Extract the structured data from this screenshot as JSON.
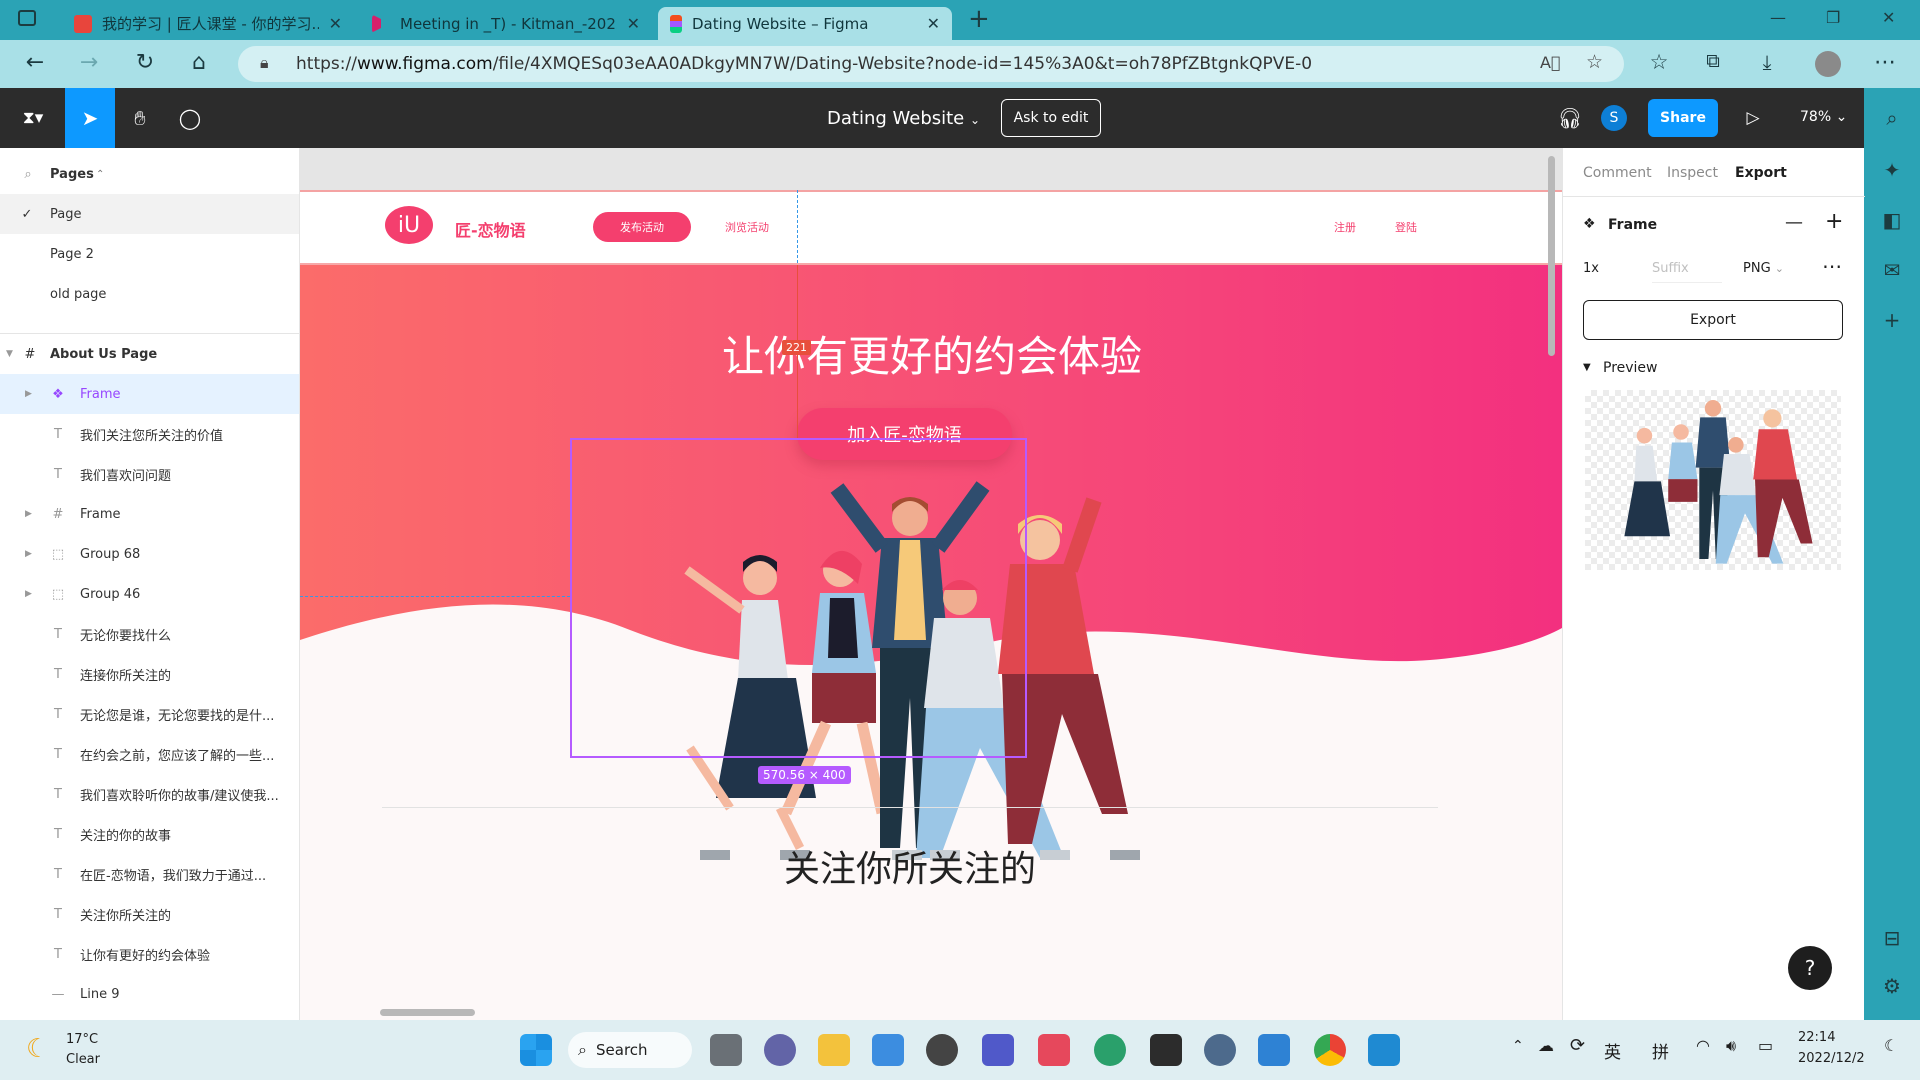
{
  "browser": {
    "tabs": [
      {
        "label": "我的学习 | 匠人课堂 - 你的学习..."
      },
      {
        "label": "Meeting in _T) - Kitman_-2022..."
      },
      {
        "label": "Dating Website – Figma"
      }
    ],
    "url_prefix": "https://",
    "url_main": "www.figma.com",
    "url_rest": "/file/4XMQESq03eAA0ADkgyMN7W/Dating-Website?node-id=145%3A0&t=oh78PfZBtgnkQPVE-0"
  },
  "figma": {
    "doc_title": "Dating Website",
    "ask_to_edit": "Ask to edit",
    "share": "Share",
    "avatar": "S",
    "zoom": "78%"
  },
  "layers": {
    "pages_header": "Pages",
    "pages": [
      "Page",
      "Page 2",
      "old page"
    ],
    "section": "About Us Page",
    "items": [
      {
        "icon": "component-icon",
        "label": "Frame",
        "expand": true,
        "selected": true
      },
      {
        "icon": "text-icon",
        "label": "我们关注您所关注的价值"
      },
      {
        "icon": "text-icon",
        "label": "我们喜欢问问题"
      },
      {
        "icon": "frame-icon",
        "label": "Frame",
        "expand": true
      },
      {
        "icon": "group-icon",
        "label": "Group 68",
        "expand": true
      },
      {
        "icon": "group-icon",
        "label": "Group 46",
        "expand": true
      },
      {
        "icon": "text-icon",
        "label": "无论你要找什么"
      },
      {
        "icon": "text-icon",
        "label": "连接你所关注的"
      },
      {
        "icon": "text-icon",
        "label": "无论您是谁，无论您要找的是什..."
      },
      {
        "icon": "text-icon",
        "label": "在约会之前，您应该了解的一些..."
      },
      {
        "icon": "text-icon",
        "label": "我们喜欢聆听你的故事/建议使我..."
      },
      {
        "icon": "text-icon",
        "label": "关注的你的故事"
      },
      {
        "icon": "text-icon",
        "label": "在匠-恋物语，我们致力于通过..."
      },
      {
        "icon": "text-icon",
        "label": "关注你所关注的"
      },
      {
        "icon": "text-icon",
        "label": "让你有更好的约会体验"
      },
      {
        "icon": "line-icon",
        "label": "Line 9"
      }
    ]
  },
  "design": {
    "logo": "iU",
    "brand": "匠-恋物语",
    "nav_publish": "发布活动",
    "nav_browse": "浏览活动",
    "nav_register": "注册",
    "nav_login": "登陆",
    "hero_title": "让你有更好的约会体验",
    "hero_cta": "加入匠-恋物语",
    "measure": "221",
    "frame_size": "570.56 × 400",
    "section_title": "关注你所关注的",
    "accent": "#f43f6e"
  },
  "inspector": {
    "tabs": [
      "Comment",
      "Inspect",
      "Export"
    ],
    "active_tab": "Export",
    "frame_label": "Frame",
    "scale": "1x",
    "suffix_placeholder": "Suffix",
    "format": "PNG",
    "export_button": "Export",
    "preview_label": "Preview"
  },
  "taskbar": {
    "weather_temp": "17°C",
    "weather_desc": "Clear",
    "search": "Search",
    "ime1": "英",
    "ime2": "拼",
    "time": "22:14",
    "date": "2022/12/2"
  }
}
